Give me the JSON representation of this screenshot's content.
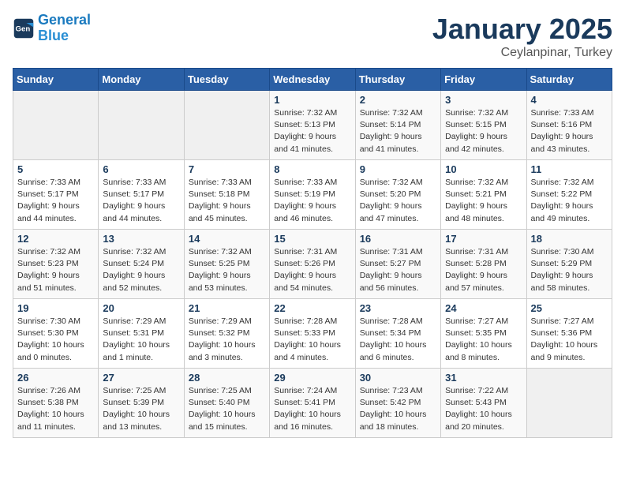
{
  "header": {
    "logo_line1": "General",
    "logo_line2": "Blue",
    "title": "January 2025",
    "subtitle": "Ceylanpinar, Turkey"
  },
  "weekdays": [
    "Sunday",
    "Monday",
    "Tuesday",
    "Wednesday",
    "Thursday",
    "Friday",
    "Saturday"
  ],
  "weeks": [
    [
      {
        "day": "",
        "empty": true
      },
      {
        "day": "",
        "empty": true
      },
      {
        "day": "",
        "empty": true
      },
      {
        "day": "1",
        "sunrise": "7:32 AM",
        "sunset": "5:13 PM",
        "daylight": "9 hours and 41 minutes."
      },
      {
        "day": "2",
        "sunrise": "7:32 AM",
        "sunset": "5:14 PM",
        "daylight": "9 hours and 41 minutes."
      },
      {
        "day": "3",
        "sunrise": "7:32 AM",
        "sunset": "5:15 PM",
        "daylight": "9 hours and 42 minutes."
      },
      {
        "day": "4",
        "sunrise": "7:33 AM",
        "sunset": "5:16 PM",
        "daylight": "9 hours and 43 minutes."
      }
    ],
    [
      {
        "day": "5",
        "sunrise": "7:33 AM",
        "sunset": "5:17 PM",
        "daylight": "9 hours and 44 minutes."
      },
      {
        "day": "6",
        "sunrise": "7:33 AM",
        "sunset": "5:17 PM",
        "daylight": "9 hours and 44 minutes."
      },
      {
        "day": "7",
        "sunrise": "7:33 AM",
        "sunset": "5:18 PM",
        "daylight": "9 hours and 45 minutes."
      },
      {
        "day": "8",
        "sunrise": "7:33 AM",
        "sunset": "5:19 PM",
        "daylight": "9 hours and 46 minutes."
      },
      {
        "day": "9",
        "sunrise": "7:32 AM",
        "sunset": "5:20 PM",
        "daylight": "9 hours and 47 minutes."
      },
      {
        "day": "10",
        "sunrise": "7:32 AM",
        "sunset": "5:21 PM",
        "daylight": "9 hours and 48 minutes."
      },
      {
        "day": "11",
        "sunrise": "7:32 AM",
        "sunset": "5:22 PM",
        "daylight": "9 hours and 49 minutes."
      }
    ],
    [
      {
        "day": "12",
        "sunrise": "7:32 AM",
        "sunset": "5:23 PM",
        "daylight": "9 hours and 51 minutes."
      },
      {
        "day": "13",
        "sunrise": "7:32 AM",
        "sunset": "5:24 PM",
        "daylight": "9 hours and 52 minutes."
      },
      {
        "day": "14",
        "sunrise": "7:32 AM",
        "sunset": "5:25 PM",
        "daylight": "9 hours and 53 minutes."
      },
      {
        "day": "15",
        "sunrise": "7:31 AM",
        "sunset": "5:26 PM",
        "daylight": "9 hours and 54 minutes."
      },
      {
        "day": "16",
        "sunrise": "7:31 AM",
        "sunset": "5:27 PM",
        "daylight": "9 hours and 56 minutes."
      },
      {
        "day": "17",
        "sunrise": "7:31 AM",
        "sunset": "5:28 PM",
        "daylight": "9 hours and 57 minutes."
      },
      {
        "day": "18",
        "sunrise": "7:30 AM",
        "sunset": "5:29 PM",
        "daylight": "9 hours and 58 minutes."
      }
    ],
    [
      {
        "day": "19",
        "sunrise": "7:30 AM",
        "sunset": "5:30 PM",
        "daylight": "10 hours and 0 minutes."
      },
      {
        "day": "20",
        "sunrise": "7:29 AM",
        "sunset": "5:31 PM",
        "daylight": "10 hours and 1 minute."
      },
      {
        "day": "21",
        "sunrise": "7:29 AM",
        "sunset": "5:32 PM",
        "daylight": "10 hours and 3 minutes."
      },
      {
        "day": "22",
        "sunrise": "7:28 AM",
        "sunset": "5:33 PM",
        "daylight": "10 hours and 4 minutes."
      },
      {
        "day": "23",
        "sunrise": "7:28 AM",
        "sunset": "5:34 PM",
        "daylight": "10 hours and 6 minutes."
      },
      {
        "day": "24",
        "sunrise": "7:27 AM",
        "sunset": "5:35 PM",
        "daylight": "10 hours and 8 minutes."
      },
      {
        "day": "25",
        "sunrise": "7:27 AM",
        "sunset": "5:36 PM",
        "daylight": "10 hours and 9 minutes."
      }
    ],
    [
      {
        "day": "26",
        "sunrise": "7:26 AM",
        "sunset": "5:38 PM",
        "daylight": "10 hours and 11 minutes."
      },
      {
        "day": "27",
        "sunrise": "7:25 AM",
        "sunset": "5:39 PM",
        "daylight": "10 hours and 13 minutes."
      },
      {
        "day": "28",
        "sunrise": "7:25 AM",
        "sunset": "5:40 PM",
        "daylight": "10 hours and 15 minutes."
      },
      {
        "day": "29",
        "sunrise": "7:24 AM",
        "sunset": "5:41 PM",
        "daylight": "10 hours and 16 minutes."
      },
      {
        "day": "30",
        "sunrise": "7:23 AM",
        "sunset": "5:42 PM",
        "daylight": "10 hours and 18 minutes."
      },
      {
        "day": "31",
        "sunrise": "7:22 AM",
        "sunset": "5:43 PM",
        "daylight": "10 hours and 20 minutes."
      },
      {
        "day": "",
        "empty": true
      }
    ]
  ]
}
